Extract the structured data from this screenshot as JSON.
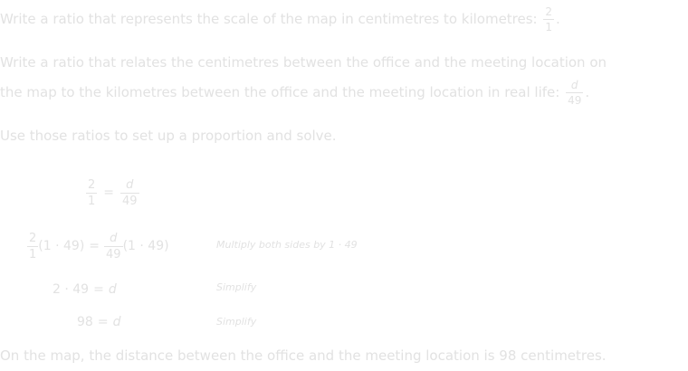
{
  "p1": {
    "text": "Write a ratio that represents the scale of the map in centimetres to kilometres:",
    "frac_num": "2",
    "frac_den": "1",
    "end": "."
  },
  "p2": {
    "line1": "Write a ratio that relates the centimetres between the office and the meeting location on",
    "line2": "the map to the kilometres between the office and the meeting location in real life:",
    "frac_num": "d",
    "frac_den": "49",
    "end": "."
  },
  "p3": {
    "text": "Use those ratios to set up a proportion and solve."
  },
  "steps": {
    "s1": {
      "lhs_num": "2",
      "lhs_den": "1",
      "eq": "=",
      "rhs_num": "d",
      "rhs_den": "49"
    },
    "s2": {
      "lhs_num": "2",
      "lhs_den": "1",
      "lhs_tail": "(1 · 49)",
      "eq": "=",
      "rhs_num": "d",
      "rhs_den": "49",
      "rhs_tail": "(1 · 49)",
      "note": "Multiply both sides by 1 · 49"
    },
    "s3": {
      "lhs": "2 · 49",
      "eq": "=",
      "rhs": "d",
      "note": "Simplify"
    },
    "s4": {
      "lhs": "98",
      "eq": "=",
      "rhs": "d",
      "note": "Simplify"
    }
  },
  "conclusion": {
    "text": "On the map, the distance between the office and the meeting location is 98 centimetres."
  },
  "colors": {
    "text": "#e2e2e2",
    "background": "#ffffff"
  }
}
